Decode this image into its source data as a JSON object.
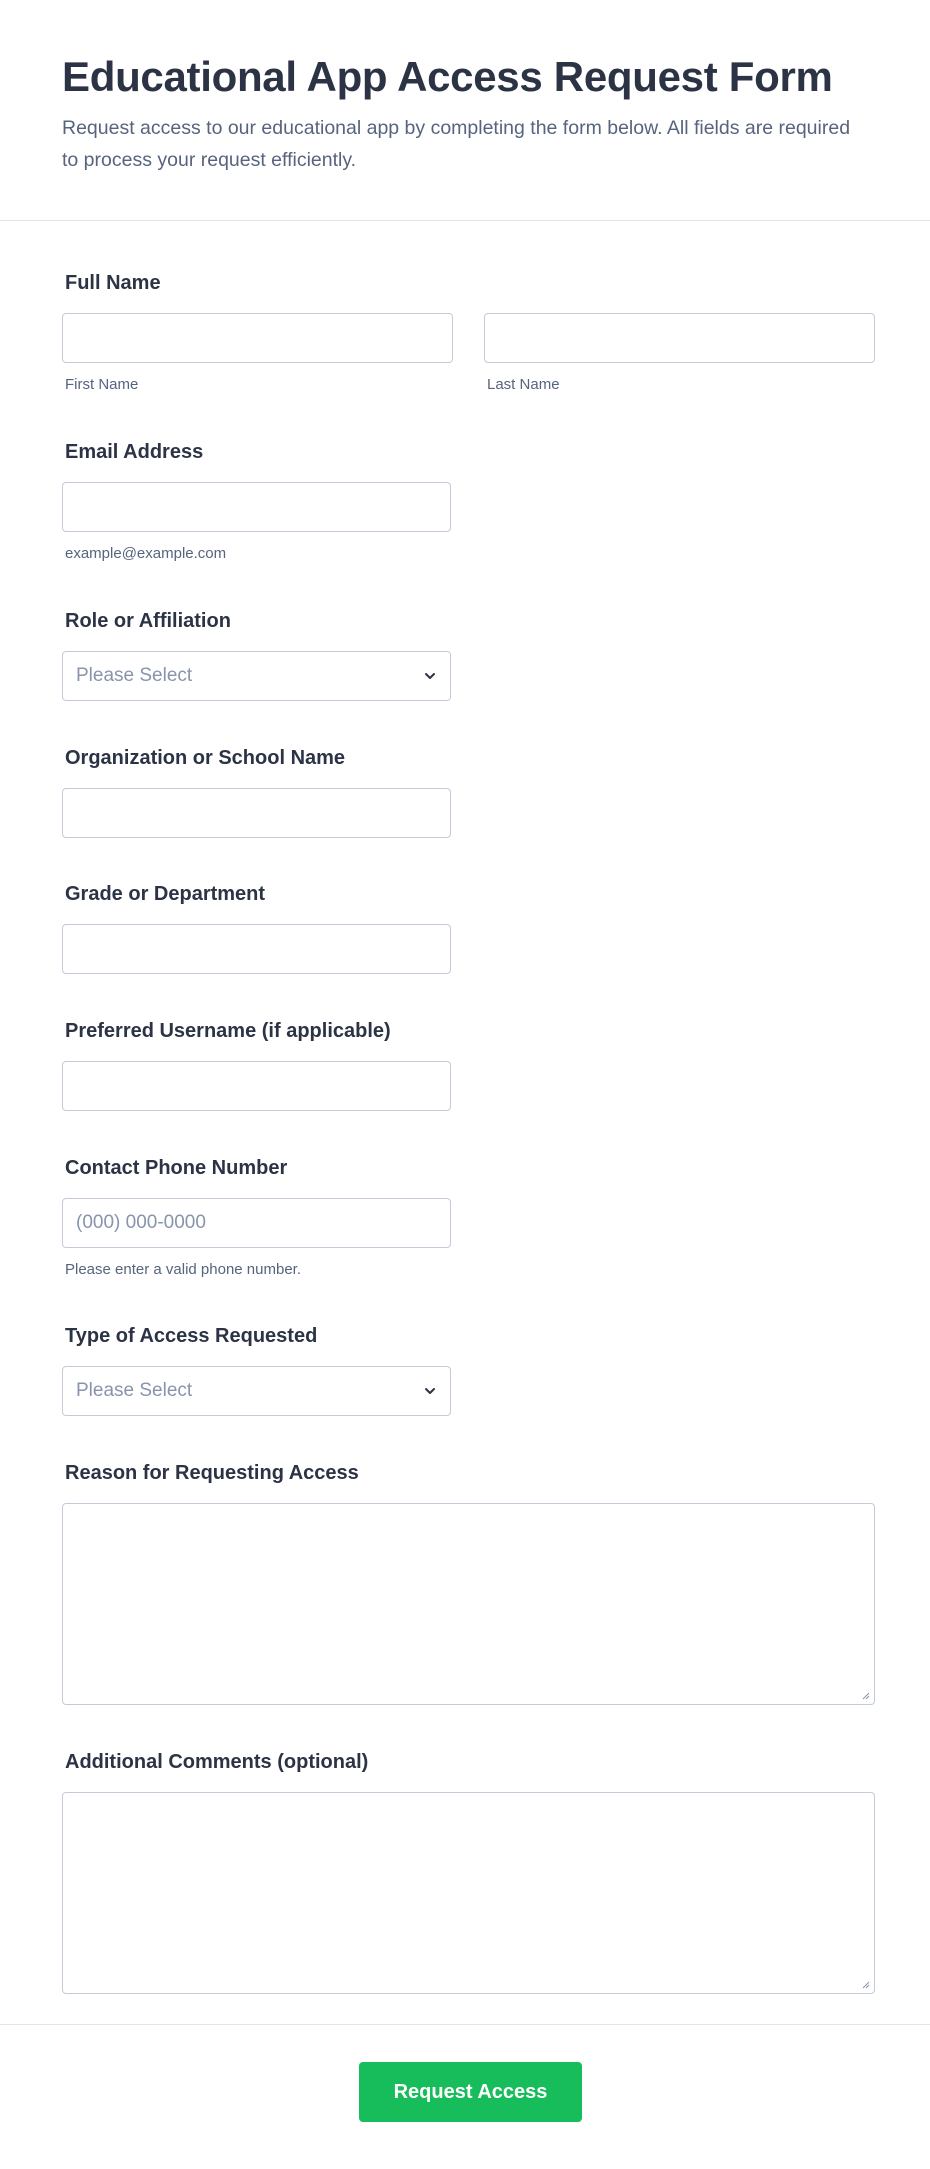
{
  "form": {
    "title": "Educational App Access Request Form",
    "description": "Request access to our educational app by completing the form below. All fields are required to process your request efficiently."
  },
  "fields": {
    "full_name": {
      "label": "Full Name",
      "first_sublabel": "First Name",
      "last_sublabel": "Last Name",
      "first_value": "",
      "last_value": ""
    },
    "email": {
      "label": "Email Address",
      "sublabel": "example@example.com",
      "value": ""
    },
    "role": {
      "label": "Role or Affiliation",
      "selected": "Please Select"
    },
    "organization": {
      "label": "Organization or School Name",
      "value": ""
    },
    "grade": {
      "label": "Grade or Department",
      "value": ""
    },
    "username": {
      "label": "Preferred Username (if applicable)",
      "value": ""
    },
    "phone": {
      "label": "Contact Phone Number",
      "placeholder": "(000) 000-0000",
      "sublabel": "Please enter a valid phone number."
    },
    "access_type": {
      "label": "Type of Access Requested",
      "selected": "Please Select"
    },
    "reason": {
      "label": "Reason for Requesting Access",
      "value": ""
    },
    "comments": {
      "label": "Additional Comments (optional)",
      "value": ""
    }
  },
  "submit": {
    "label": "Request Access"
  },
  "colors": {
    "submit_bg": "#18bd5b",
    "text": "#2c3345",
    "subtext": "#57647e",
    "border": "#c3cad8",
    "placeholder": "#8894ab"
  },
  "icons": {
    "select": "chevron-down-icon",
    "textarea_resize": "resize-grip-icon"
  }
}
